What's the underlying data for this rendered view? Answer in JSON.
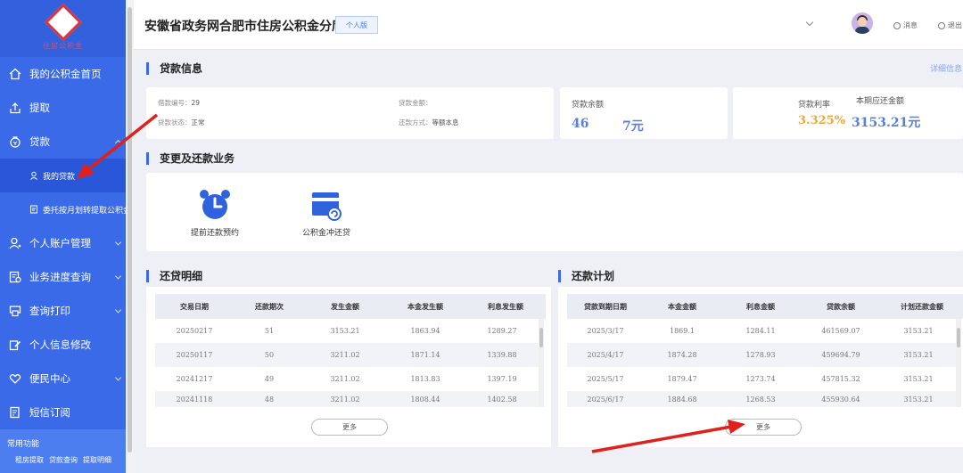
{
  "sidebar": {
    "logo_text": "住房公积金",
    "items": [
      {
        "label": "我的公积金首页",
        "icon": "home-icon"
      },
      {
        "label": "提取",
        "icon": "upload-icon"
      },
      {
        "label": "贷款",
        "icon": "loan-icon"
      },
      {
        "label": "个人账户管理",
        "icon": "person-icon"
      },
      {
        "label": "业务进度查询",
        "icon": "progress-icon"
      },
      {
        "label": "查询打印",
        "icon": "print-icon"
      },
      {
        "label": "个人信息修改",
        "icon": "edit-icon"
      },
      {
        "label": "便民中心",
        "icon": "heart-icon"
      },
      {
        "label": "短信订阅",
        "icon": "sms-icon"
      }
    ],
    "sub_items": [
      {
        "label": "我的贷款",
        "icon": "user-loan-icon"
      },
      {
        "label": "委托按月划转提取公积金",
        "icon": "document-icon"
      }
    ],
    "common": {
      "title": "常用功能",
      "links": [
        "租房提取",
        "贷款查询",
        "提取明细"
      ]
    }
  },
  "header": {
    "title": "安徽省政务网合肥市住房公积金分厅",
    "badge": "个人版",
    "messages": "消息",
    "logout": "退出"
  },
  "loan_info": {
    "section_title": "贷款信息",
    "detail_link": "详细信息",
    "contract_label": "借款编号：",
    "contract_value": "29",
    "status_label": "贷款状态：",
    "status_value": "正常",
    "amount_label": "贷款金额：",
    "amount_value": "",
    "method_label": "还款方式：",
    "method_value": "等额本息",
    "balance_label": "贷款余额",
    "balance_value_a": "46",
    "balance_value_b": "7元",
    "rate_label": "贷款利率",
    "rate_value": "3.325%",
    "due_label": "本期应还金额",
    "due_value": "3153.21元",
    "accent_colors": {
      "rate": "#f0a73a",
      "amount": "#5b7fd6"
    }
  },
  "business": {
    "section_title": "变更及还款业务",
    "items": [
      {
        "label": "提前还款预约",
        "icon": "alarm-clock-icon"
      },
      {
        "label": "公积金冲还贷",
        "icon": "card-refresh-icon"
      }
    ]
  },
  "repay_detail": {
    "section_title": "还贷明细",
    "columns": [
      "交易日期",
      "还款期次",
      "发生金额",
      "本金发生额",
      "利息发生额"
    ],
    "rows": [
      [
        "20250217",
        "51",
        "3153.21",
        "1863.94",
        "1289.27"
      ],
      [
        "20250117",
        "50",
        "3211.02",
        "1871.14",
        "1339.88"
      ],
      [
        "20241217",
        "49",
        "3211.02",
        "1813.83",
        "1397.19"
      ],
      [
        "20241118",
        "48",
        "3211.02",
        "1808.44",
        "1402.58"
      ]
    ],
    "more_label": "更多"
  },
  "repay_plan": {
    "section_title": "还款计划",
    "columns": [
      "贷款到期日期",
      "本金金额",
      "利息金额",
      "贷款余额",
      "计划还款金额"
    ],
    "rows": [
      [
        "2025/3/17",
        "1869.1",
        "1284.11",
        "461569.07",
        "3153.21"
      ],
      [
        "2025/4/17",
        "1874.28",
        "1278.93",
        "459694.79",
        "3153.21"
      ],
      [
        "2025/5/17",
        "1879.47",
        "1273.74",
        "457815.32",
        "3153.21"
      ],
      [
        "2025/6/17",
        "1884.68",
        "1268.53",
        "455930.64",
        "3153.21"
      ]
    ],
    "more_label": "更多"
  }
}
